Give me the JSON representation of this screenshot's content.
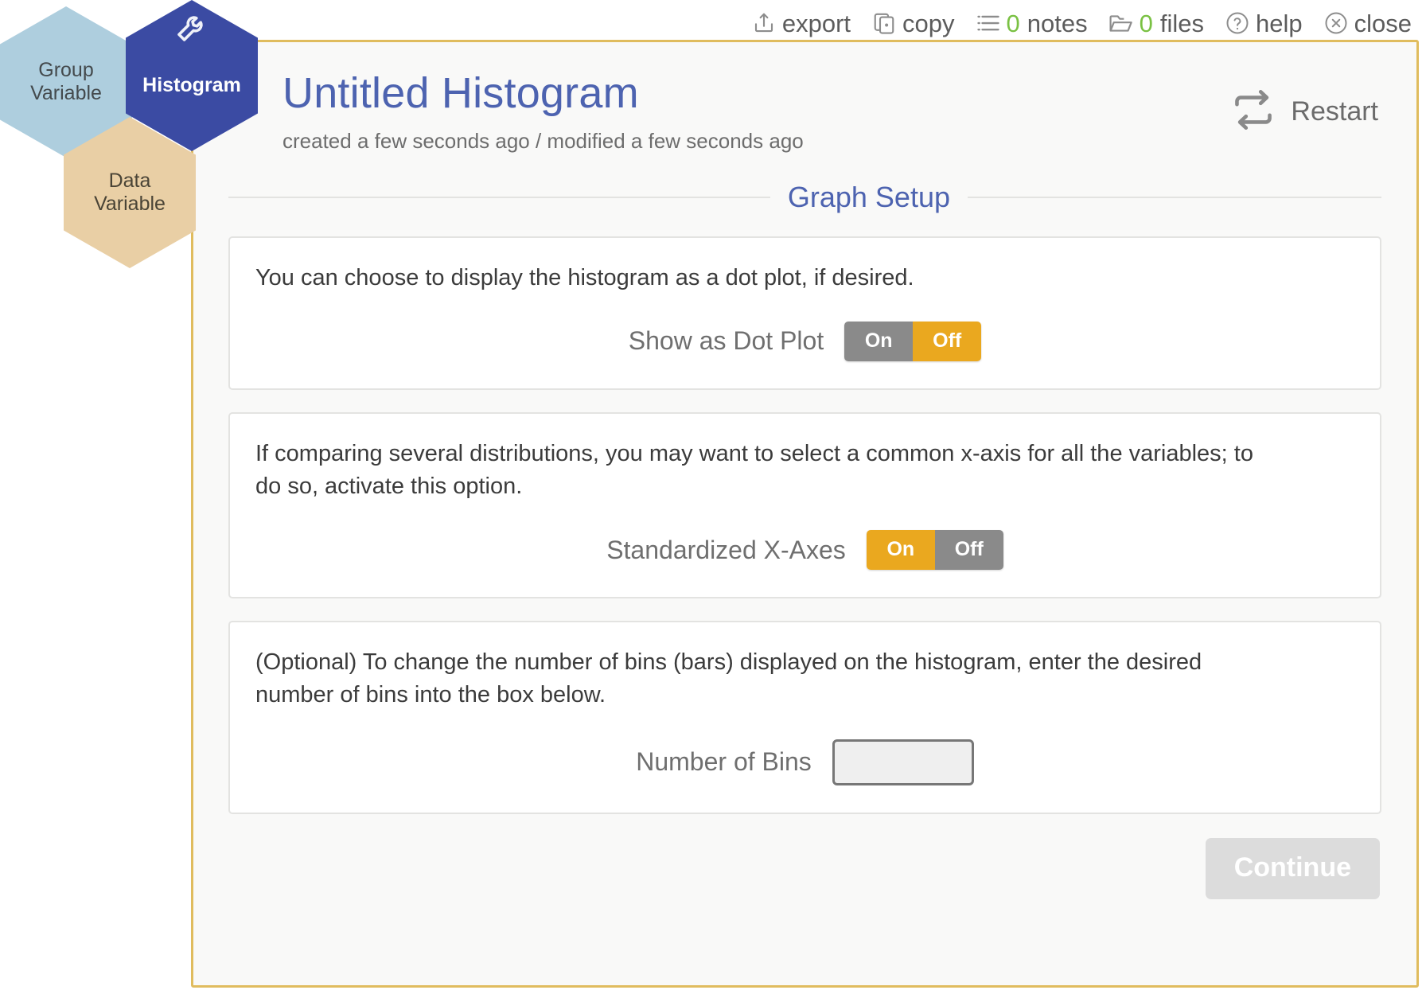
{
  "toolbar": {
    "items": [
      {
        "icon": "export-icon",
        "label": "export",
        "count": null
      },
      {
        "icon": "copy-icon",
        "label": "copy",
        "count": null
      },
      {
        "icon": "notes-icon",
        "label": "notes",
        "count": "0"
      },
      {
        "icon": "files-icon",
        "label": "files",
        "count": "0"
      },
      {
        "icon": "help-icon",
        "label": "help",
        "count": null
      },
      {
        "icon": "close-icon",
        "label": "close",
        "count": null
      }
    ],
    "export_label": "export",
    "copy_label": "copy",
    "notes_count": "0",
    "notes_label": "notes",
    "files_count": "0",
    "files_label": "files",
    "help_label": "help",
    "close_label": "close"
  },
  "hex_nav": {
    "group_variable": "Group\nVariable",
    "group_variable_line1": "Group",
    "group_variable_line2": "Variable",
    "histogram": "Histogram",
    "data_variable_line1": "Data",
    "data_variable_line2": "Variable"
  },
  "header": {
    "title": "Untitled Histogram",
    "meta": "created a few seconds ago / modified a few seconds ago",
    "restart_label": "Restart"
  },
  "section": {
    "title": "Graph Setup"
  },
  "cards": [
    {
      "text": "You can choose to display the histogram as a dot plot, if desired.",
      "field_label": "Show as Dot Plot",
      "control": "toggle",
      "on_label": "On",
      "off_label": "Off",
      "selected": "Off"
    },
    {
      "text": "If comparing several distributions, you may want to select a common x-axis for all the variables; to do so, activate this option.",
      "field_label": "Standardized X-Axes",
      "control": "toggle",
      "on_label": "On",
      "off_label": "Off",
      "selected": "On"
    },
    {
      "text": "(Optional) To change the number of bins (bars) displayed on the histogram, enter the desired number of bins into the box below.",
      "field_label": "Number of Bins",
      "control": "number-input",
      "value": "",
      "placeholder": ""
    }
  ],
  "footer": {
    "continue_label": "Continue"
  },
  "colors": {
    "accent_blue": "#4d63b0",
    "panel_border_gold": "#e0bc5e",
    "toggle_on_orange": "#eaa81f",
    "toggle_off_gray": "#8a8a8a",
    "count_green": "#7ac143",
    "hex_group": "#aecede",
    "hex_histogram": "#3b4ba3",
    "hex_data": "#e9cfa5"
  }
}
